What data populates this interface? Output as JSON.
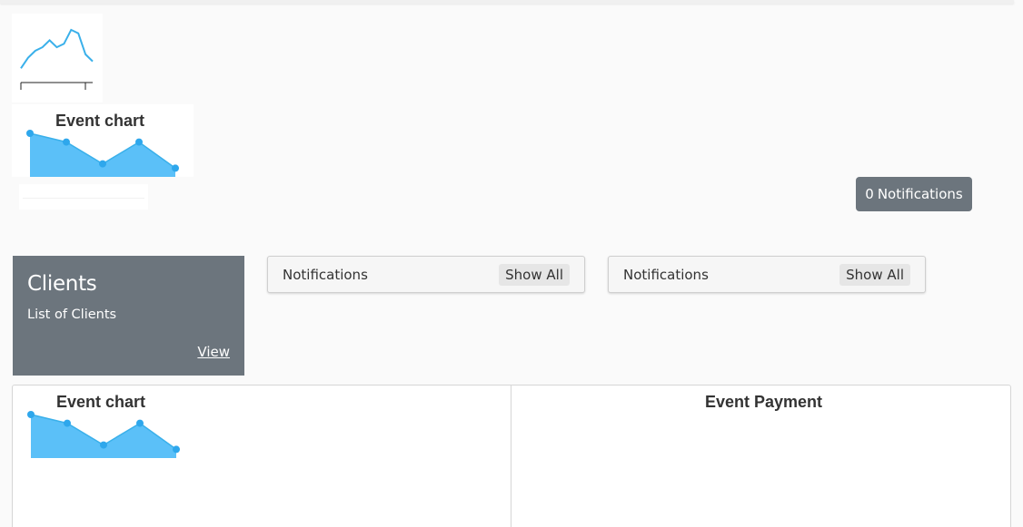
{
  "colors": {
    "line": "#3ab0ea",
    "area_fill": "#5bc0f8",
    "point": "#2ea7ec",
    "secondary": "#6c757d"
  },
  "icons": [
    "sparkline-chart"
  ],
  "sparkline": {
    "chart_data": {
      "type": "line",
      "values": [
        2,
        5,
        7,
        8,
        10,
        8,
        9,
        13,
        12,
        6,
        4
      ],
      "ylim": [
        0,
        14
      ],
      "title": ""
    }
  },
  "event_chart_top": {
    "chart_data": {
      "type": "area",
      "title": "Event chart",
      "values": [
        10,
        8,
        3,
        8,
        2
      ],
      "ylim": [
        0,
        10
      ]
    }
  },
  "notifications_button": {
    "count": "0",
    "label": "Notifications"
  },
  "clients_card": {
    "title": "Clients",
    "subtitle": "List of Clients",
    "link": "View"
  },
  "notification_panels": [
    {
      "label": "Notifications",
      "action": "Show All"
    },
    {
      "label": "Notifications",
      "action": "Show All"
    }
  ],
  "bottom": {
    "event_chart": {
      "chart_data": {
        "type": "area",
        "title": "Event chart",
        "values": [
          10,
          8,
          3,
          8,
          2
        ],
        "ylim": [
          0,
          10
        ]
      }
    },
    "event_payment": {
      "title": "Event Payment"
    }
  }
}
